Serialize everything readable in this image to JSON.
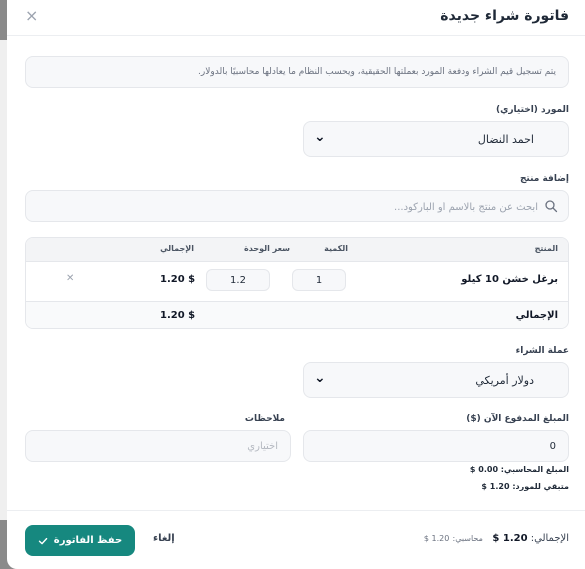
{
  "modal": {
    "title": "فاتورة شراء جديدة",
    "close_icon": "×",
    "info_text": "يتم تسجيل قيم الشراء ودفعة المورد بعملتها الحقيقية، ويحسب النظام ما يعادلها محاسبيًا بالدولار."
  },
  "supplier": {
    "label": "المورد (اختياري)",
    "value": "احمد النضال",
    "icon": "chevron-down-icon"
  },
  "add_product": {
    "label": "إضافة منتج",
    "placeholder": "ابحث عن منتج بالاسم أو الباركود...",
    "icon": "search-icon"
  },
  "items_table": {
    "headers": {
      "product": "المنتج",
      "quantity": "الكمية",
      "unit_price": "سعر الوحدة",
      "total": "الإجمالي"
    },
    "rows": [
      {
        "product": "برغل خشن 10 كيلو",
        "quantity": "1",
        "unit_price": "1.2",
        "total": "1.20 $"
      }
    ],
    "footer": {
      "label": "الإجمالي",
      "total": "1.20 $"
    }
  },
  "currency": {
    "label": "عملة الشراء",
    "value": "دولار أمريكي",
    "icon": "chevron-down-icon"
  },
  "payment": {
    "label": "المبلغ المدفوع الآن ($)",
    "value": "0",
    "accounting_amount": "المبلغ المحاسبي: 0.00 $",
    "supplier_remaining": "متبقي للمورد: 1.20 $"
  },
  "notes": {
    "label": "ملاحظات",
    "placeholder": "اختياري"
  },
  "footer": {
    "total_label": "الإجمالي:",
    "total_value": "1.20 $",
    "accounting_label": "محاسبي:",
    "accounting_value": "1.20 $",
    "cancel_label": "إلغاء",
    "save_label": "حفظ الفاتورة"
  },
  "colors": {
    "primary": "#16887f",
    "backdrop": "#8a8a8a"
  }
}
